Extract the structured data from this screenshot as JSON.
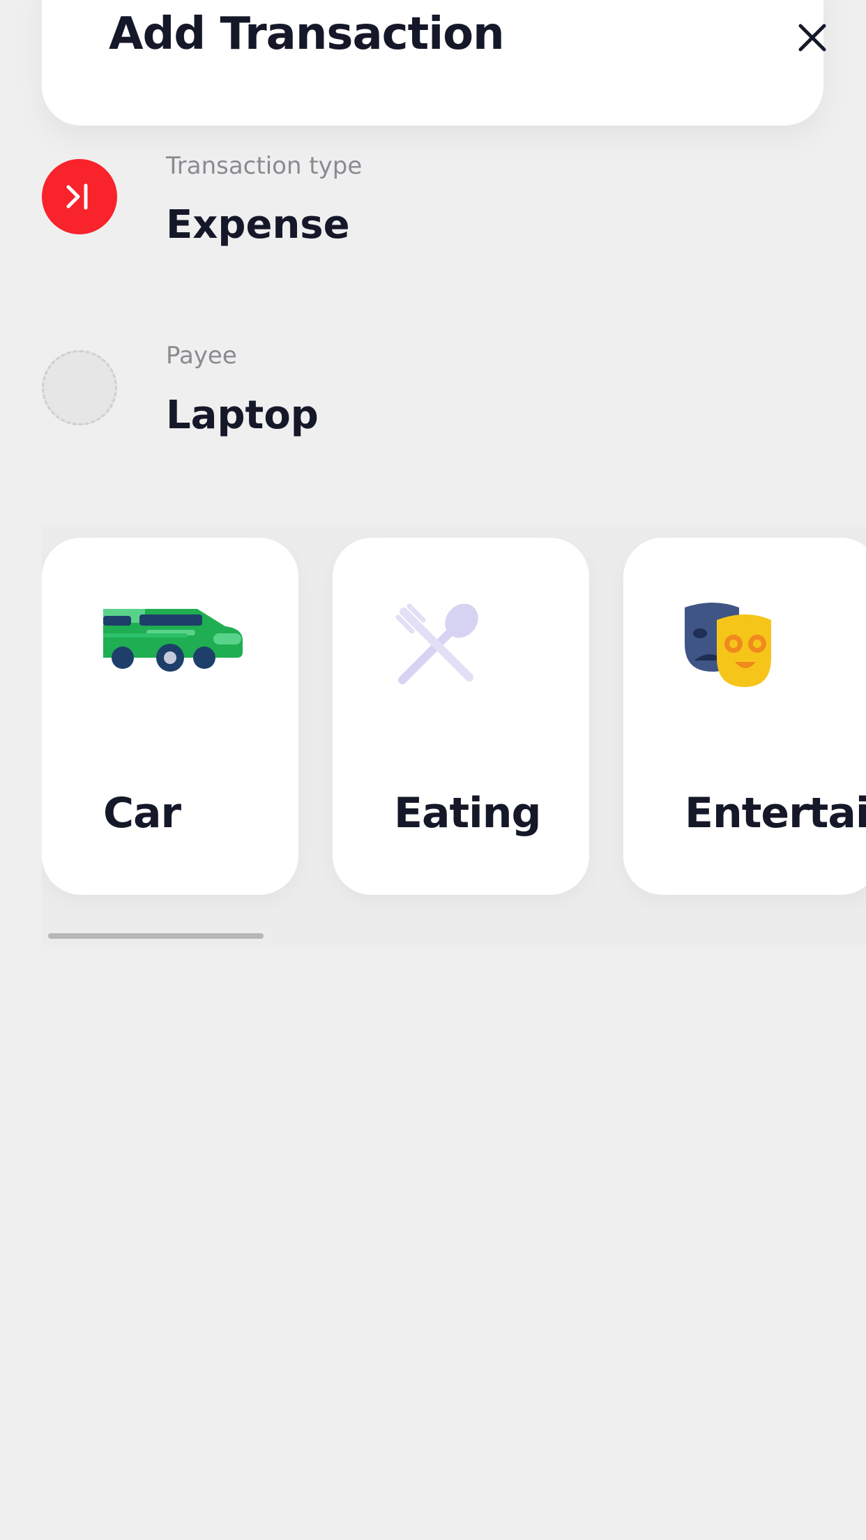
{
  "header": {
    "title": "Add Transaction",
    "close_icon": "close-icon"
  },
  "transaction_type": {
    "label": "Transaction type",
    "value": "Expense",
    "icon": "skip-forward-icon",
    "icon_color": "#f8232b"
  },
  "payee": {
    "label": "Payee",
    "value": "Laptop",
    "icon": "empty-avatar-placeholder"
  },
  "categories": [
    {
      "label": "Car",
      "icon": "car-icon"
    },
    {
      "label": "Eating",
      "icon": "fork-spoon-icon"
    },
    {
      "label": "Entertainment",
      "icon": "theater-masks-icon"
    }
  ],
  "colors": {
    "background": "#efeff0",
    "text": "#151828",
    "label": "#8a8a90",
    "accent": "#f8232b"
  }
}
